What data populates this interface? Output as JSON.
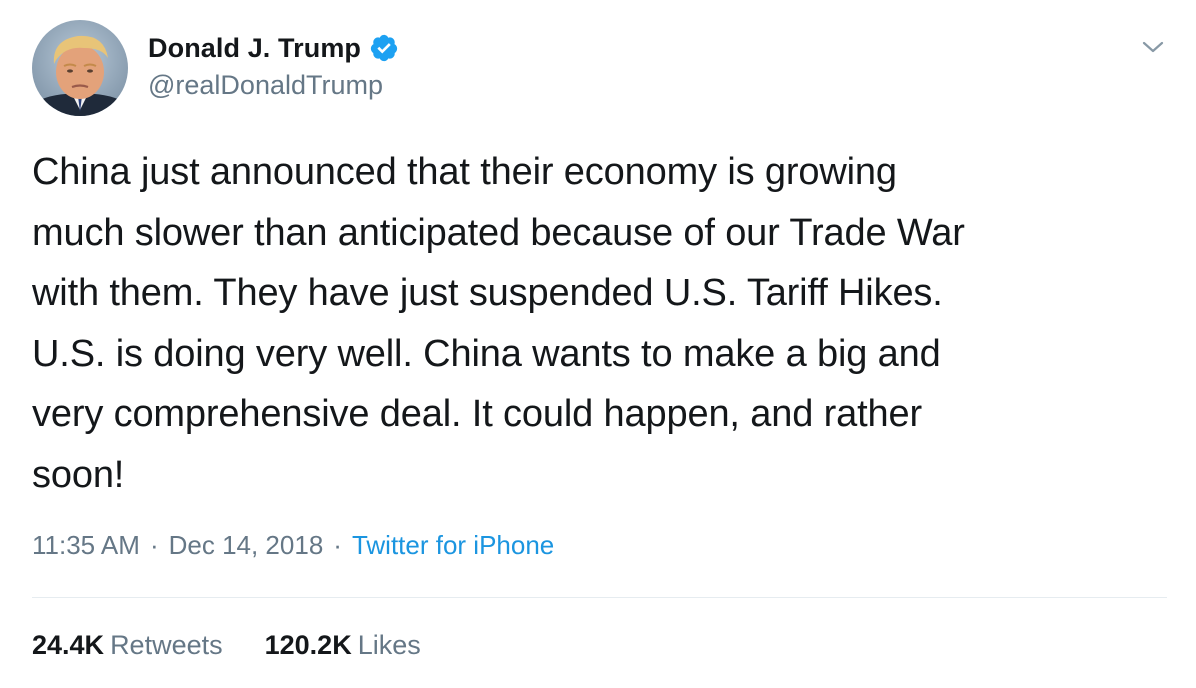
{
  "author": {
    "display_name": "Donald J. Trump",
    "handle": "@realDonaldTrump",
    "verified": true
  },
  "tweet": {
    "text_lines": [
      "China just announced that their economy is growing",
      "much slower than anticipated because of our Trade War",
      "with them. They have just suspended U.S. Tariff Hikes.",
      "U.S. is doing very well. China wants to make a big and",
      "very comprehensive deal. It could happen, and rather",
      "soon!"
    ],
    "timestamp": "11:35 AM",
    "separator": "·",
    "date": "Dec 14, 2018",
    "source": "Twitter for iPhone"
  },
  "stats": {
    "retweets_count": "24.4K",
    "retweets_label": "Retweets",
    "likes_count": "120.2K",
    "likes_label": "Likes"
  },
  "icons": {
    "verified": "verified-badge-icon",
    "caret": "chevron-down-icon"
  },
  "colors": {
    "text_primary": "#14171a",
    "text_secondary": "#657786",
    "link": "#1b95e0",
    "verified": "#1da1f2",
    "divider": "#e6ecf0"
  }
}
